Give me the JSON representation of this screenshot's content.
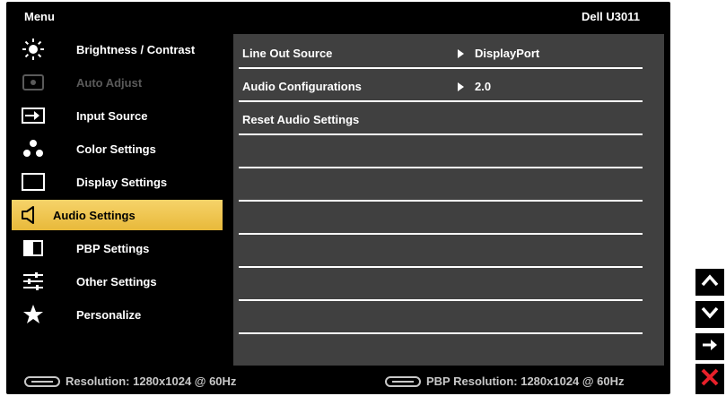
{
  "header": {
    "menu_title": "Menu",
    "model": "Dell U3011"
  },
  "sidebar": {
    "items": [
      {
        "label": "Brightness / Contrast",
        "icon": "sun-icon",
        "state": "normal"
      },
      {
        "label": "Auto Adjust",
        "icon": "auto-adjust-icon",
        "state": "disabled"
      },
      {
        "label": "Input Source",
        "icon": "input-source-icon",
        "state": "normal"
      },
      {
        "label": "Color Settings",
        "icon": "color-dots-icon",
        "state": "normal"
      },
      {
        "label": "Display Settings",
        "icon": "display-rect-icon",
        "state": "normal"
      },
      {
        "label": "Audio Settings",
        "icon": "speaker-icon",
        "state": "active"
      },
      {
        "label": "PBP Settings",
        "icon": "pbp-icon",
        "state": "normal"
      },
      {
        "label": "Other Settings",
        "icon": "sliders-icon",
        "state": "normal"
      },
      {
        "label": "Personalize",
        "icon": "star-icon",
        "state": "normal"
      }
    ]
  },
  "panel": {
    "rows": [
      {
        "label": "Line Out Source",
        "value": "DisplayPort"
      },
      {
        "label": "Audio Configurations",
        "value": "2.0"
      },
      {
        "label": "Reset Audio Settings",
        "value": ""
      },
      {
        "label": "",
        "value": ""
      },
      {
        "label": "",
        "value": ""
      },
      {
        "label": "",
        "value": ""
      },
      {
        "label": "",
        "value": ""
      },
      {
        "label": "",
        "value": ""
      },
      {
        "label": "",
        "value": ""
      }
    ]
  },
  "footer": {
    "resolution": "Resolution: 1280x1024 @ 60Hz",
    "pbp_resolution": "PBP Resolution: 1280x1024 @ 60Hz"
  },
  "side_buttons": [
    {
      "icon": "chevron-up-icon"
    },
    {
      "icon": "chevron-down-icon"
    },
    {
      "icon": "arrow-right-icon"
    },
    {
      "icon": "close-icon",
      "color": "#e8202a"
    }
  ],
  "colors": {
    "accent": "#f0c850",
    "panel": "#404040",
    "background": "#000000"
  }
}
